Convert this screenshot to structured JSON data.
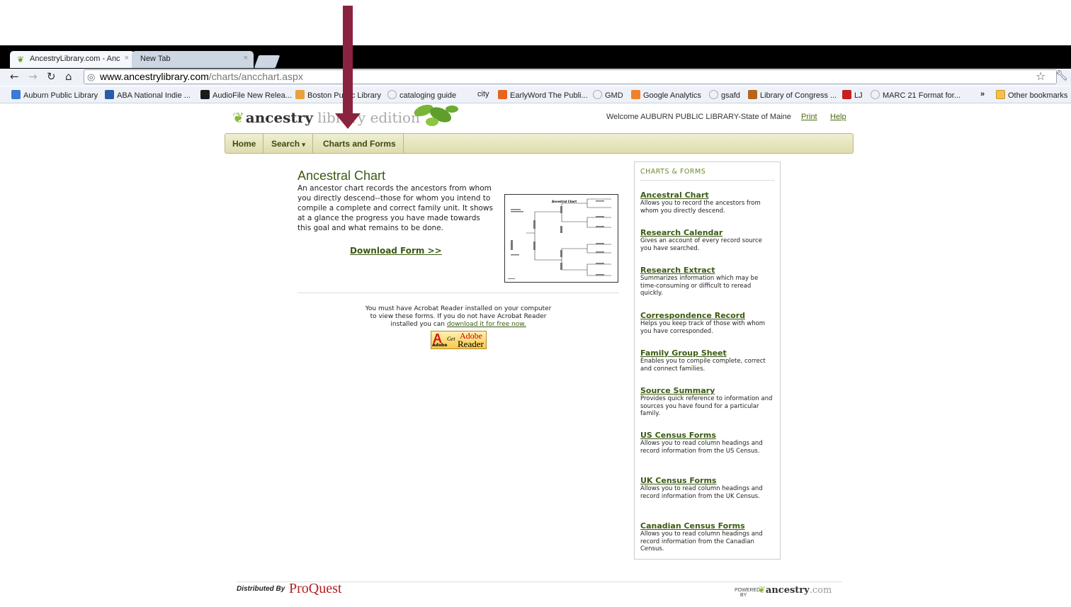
{
  "browser": {
    "tabs": [
      {
        "label": "AncestryLibrary.com - Anc",
        "active": true
      },
      {
        "label": "New Tab",
        "active": false
      }
    ],
    "close_glyph": "×",
    "url_host": "www.ancestrylibrary.com",
    "url_path": "/charts/ancchart.aspx",
    "bookmarks": [
      {
        "label": "Auburn Public Library",
        "color": "#3a7bd5"
      },
      {
        "label": "ABA National Indie ...",
        "color": "#2b5aa8"
      },
      {
        "label": "AudioFile New Relea...",
        "color": "#1b1b1b"
      },
      {
        "label": "Boston Public Library",
        "color": "#e8a23a"
      },
      {
        "label": "cataloging guide",
        "color": "#cccccc"
      },
      {
        "label": "city",
        "color": "#ffffff"
      },
      {
        "label": "EarlyWord The Publi...",
        "color": "#e8641e"
      },
      {
        "label": "GMD",
        "color": "#cccccc"
      },
      {
        "label": "Google Analytics",
        "color": "#f0822a"
      },
      {
        "label": "gsafd",
        "color": "#cccccc"
      },
      {
        "label": "Library of Congress ...",
        "color": "#b5651d"
      },
      {
        "label": "LJ",
        "color": "#c8201e"
      },
      {
        "label": "MARC 21 Format for...",
        "color": "#cccccc"
      }
    ],
    "overflow_glyph": "»",
    "other_bookmarks": "Other bookmarks"
  },
  "header": {
    "logo_ancestry": "ancestry",
    "logo_library": "library",
    "logo_edition": "edition",
    "welcome": "Welcome AUBURN PUBLIC LIBRARY-State of Maine",
    "print": "Print",
    "help": "Help"
  },
  "nav": {
    "home": "Home",
    "search": "Search",
    "charts_forms": "Charts and Forms"
  },
  "main": {
    "title": "Ancestral Chart",
    "description": "An ancestor chart records the ancestors from whom you directly descend--those for whom you intend to compile a complete and correct family unit. It shows at a glance the progress you have made towards this goal and what remains to be done.",
    "download": "Download Form >>",
    "thumb_title": "Ancestral Chart",
    "acrobat_text_1": "You must have Acrobat Reader installed on your computer",
    "acrobat_text_2": "to view these forms. If you do not have Acrobat Reader",
    "acrobat_text_3": "installed you can",
    "acrobat_link": "download it for free now.",
    "badge_adobe_small": "Adobe",
    "badge_get": "Get",
    "badge_adobe": "Adobe",
    "badge_reader": "Reader"
  },
  "sidebar": {
    "heading": "CHARTS & FORMS",
    "items": [
      {
        "title": "Ancestral Chart",
        "desc": "Allows you to record the ancestors from whom you directly descend."
      },
      {
        "title": "Research Calendar",
        "desc": "Gives an account of every record source you have searched."
      },
      {
        "title": "Research Extract",
        "desc": "Summarizes information which may be time-consuming or difficult to reread quickly."
      },
      {
        "title": "Correspondence Record",
        "desc": "Helps you keep track of those with whom you have corresponded."
      },
      {
        "title": "Family Group Sheet",
        "desc": "Enables you to compile complete, correct and connect families."
      },
      {
        "title": "Source Summary",
        "desc": "Provides quick reference to information and sources you have found for a particular family."
      },
      {
        "title": "US Census Forms",
        "desc": "Allows you to read column headings and record information from the US Census."
      },
      {
        "title": "UK Census Forms",
        "desc": "Allows you to read column headings and record information from the UK Census."
      },
      {
        "title": "Canadian Census Forms",
        "desc": "Allows you to read column headings and record information from the Canadian Census."
      }
    ]
  },
  "footer": {
    "distributed_by": "Distributed By",
    "proquest": "ProQuest",
    "powered": "POWERED",
    "by": "BY",
    "ancestry": "ancestry",
    "dotcom": ".com"
  },
  "colors": {
    "arrow": "#8a2340",
    "accent_green": "#3b5a12",
    "nav_bg": "#dedcae"
  }
}
